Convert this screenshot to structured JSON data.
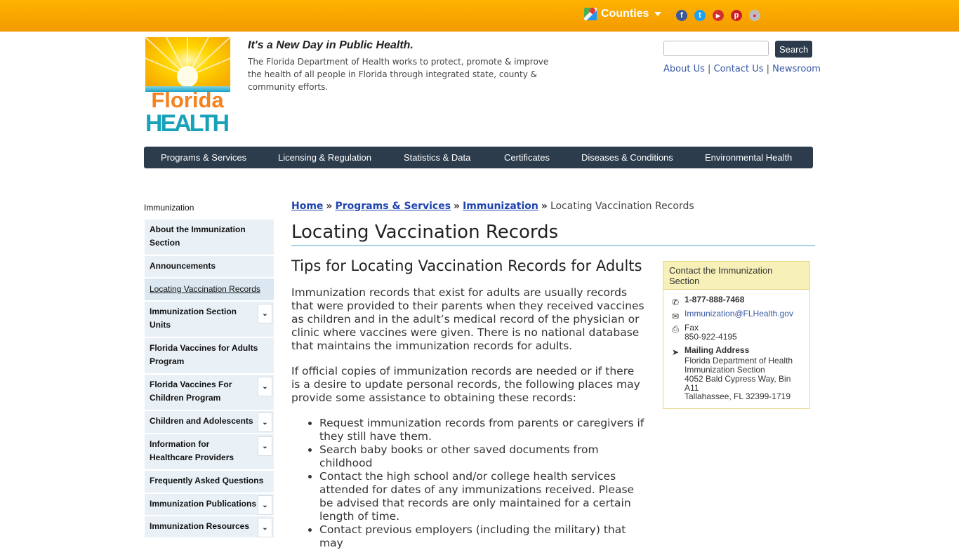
{
  "topbar": {
    "counties_label": "Counties",
    "social": [
      {
        "name": "facebook",
        "color": "#3b5998",
        "glyph": "f"
      },
      {
        "name": "twitter",
        "color": "#1da1f2",
        "glyph": "t"
      },
      {
        "name": "youtube",
        "color": "#d32f2f",
        "glyph": "▶"
      },
      {
        "name": "pinterest",
        "color": "#cb2027",
        "glyph": "p"
      },
      {
        "name": "flickr",
        "color": "#bdbdbd",
        "glyph": "●"
      }
    ]
  },
  "header": {
    "logo_text_1": "Florida",
    "logo_text_2": "HEALTH",
    "tagline": "It's a New Day in Public Health.",
    "mission": "The Florida Department of Health works to protect, promote & improve the health of all people in Florida through integrated state, county & community efforts.",
    "search_button": "Search",
    "links": [
      "About Us",
      "Contact Us",
      "Newsroom"
    ]
  },
  "nav": [
    "Programs & Services",
    "Licensing & Regulation",
    "Statistics & Data",
    "Certificates",
    "Diseases & Conditions",
    "Environmental Health"
  ],
  "sidebar": {
    "heading": "Immunization",
    "items": [
      {
        "label": "About the Immunization Section",
        "expandable": false
      },
      {
        "label": "Announcements",
        "expandable": false
      },
      {
        "label": "Locating Vaccination Records",
        "expandable": false,
        "active": true
      },
      {
        "label": "Immunization Section Units",
        "expandable": true
      },
      {
        "label": "Florida Vaccines for Adults Program",
        "expandable": false
      },
      {
        "label": "Florida Vaccines For Children Program",
        "expandable": true
      },
      {
        "label": "Children and Adolescents",
        "expandable": true
      },
      {
        "label": "Information for Healthcare Providers",
        "expandable": true
      },
      {
        "label": "Frequently Asked Questions",
        "expandable": false
      },
      {
        "label": "Immunization Publications",
        "expandable": true
      },
      {
        "label": "Immunization Resources",
        "expandable": true
      }
    ]
  },
  "breadcrumb": {
    "items": [
      "Home",
      "Programs & Services",
      "Immunization"
    ],
    "current": "Locating Vaccination Records"
  },
  "main": {
    "title": "Locating Vaccination Records",
    "subtitle": "Tips for Locating Vaccination Records for Adults",
    "para1": "Immunization records that exist for adults are usually records that were provided to their parents when they received vaccines as children and in the adult’s medical record of the physician or clinic where vaccines were given. There is no national database that maintains the immunization records for adults.",
    "para2": "If official copies of immunization records are needed or if there is a desire to update personal records, the following places may provide some assistance to obtaining these records:",
    "bullets": [
      "Request immunization records from parents or caregivers if they still have them.",
      "Search baby books or other saved documents from childhood",
      "Contact the high school and/or college health services attended for dates of any immunizations received. Please be advised that records are only maintained for a certain length of time.",
      "Contact previous employers (including the military) that may"
    ]
  },
  "contact": {
    "heading": "Contact the Immunization Section",
    "phone": "1-877-888-7468",
    "email": "Immunization@FLHealth.gov",
    "fax_label": "Fax",
    "fax": "850-922-4195",
    "mailing_label": "Mailing Address",
    "address": [
      "Florida Department of Health",
      "Immunization Section",
      "4052 Bald Cypress Way, Bin A11",
      "Tallahassee, FL 32399-1719"
    ]
  }
}
